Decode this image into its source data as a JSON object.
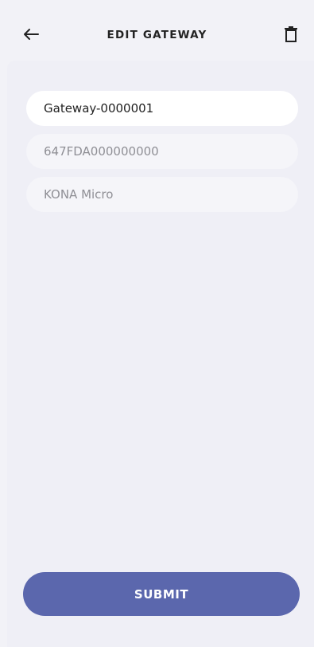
{
  "header": {
    "title": "EDIT GATEWAY",
    "back_icon": "arrow-left-icon",
    "delete_icon": "trash-icon"
  },
  "form": {
    "gateway_name": "Gateway-0000001",
    "gateway_id": "647FDA000000000",
    "gateway_model": "KONA Micro"
  },
  "actions": {
    "submit_label": "SUBMIT"
  },
  "colors": {
    "accent": "#5b67ad",
    "background": "#efeff6"
  }
}
